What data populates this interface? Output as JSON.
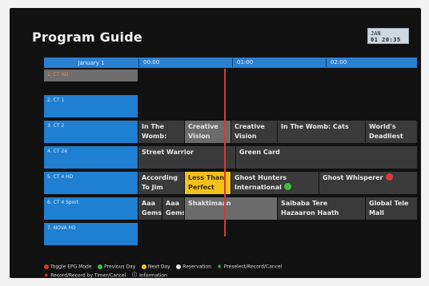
{
  "header": {
    "title": "Program Guide",
    "clock_month": "JAN",
    "clock_date": "01 20:35"
  },
  "timebar": {
    "day": "January 1",
    "times": [
      "00:00",
      "01:00",
      "02:00"
    ]
  },
  "channels": [
    {
      "label": "1. CT HD",
      "selected": true
    },
    {
      "label": "2. CT 1",
      "selected": false
    },
    {
      "label": "3. CT 2",
      "selected": false
    },
    {
      "label": "4. CT 24",
      "selected": false
    },
    {
      "label": "5. CT 4 HD",
      "selected": false
    },
    {
      "label": "6. CT 4 Sport",
      "selected": false
    },
    {
      "label": "7. NOVA HD",
      "selected": false
    }
  ],
  "programs": {
    "row3": [
      "In The Womb:",
      "Creative Vision",
      "Creative Vision",
      "In The Womb: Cats",
      "World's Deadliest"
    ],
    "row4": [
      "Street Warrior",
      "Green Card"
    ],
    "row5": [
      "According To Jim",
      "Less Than Perfect",
      "Ghost Hunters International",
      "Ghost Whisperer"
    ],
    "row6": [
      "Aaa Gems",
      "Aaa Gems",
      "Shaktimaan",
      "Saibaba Tere Hazaaron Haath",
      "Global Tele Mall"
    ]
  },
  "legend": {
    "line1": [
      {
        "icon": "red-circle-icon",
        "label": "Toggle EPG Mode"
      },
      {
        "icon": "green-circle-icon",
        "label": "Previous Day"
      },
      {
        "icon": "yellow-circle-icon",
        "label": "Next Day"
      },
      {
        "icon": "white-circle-icon",
        "label": "Reservation"
      },
      {
        "icon": "record-icon",
        "label": "Preselect/Record/Cancel"
      }
    ],
    "line2": [
      {
        "icon": "record-timer-icon",
        "label": "Record/Record by Timer/Cancel"
      },
      {
        "icon": "info-icon",
        "label": "Information"
      }
    ]
  },
  "colors": {
    "blue": "#2a7fd1",
    "accent_red": "#d43a2f",
    "highlight_yellow": "#f2c21b"
  }
}
